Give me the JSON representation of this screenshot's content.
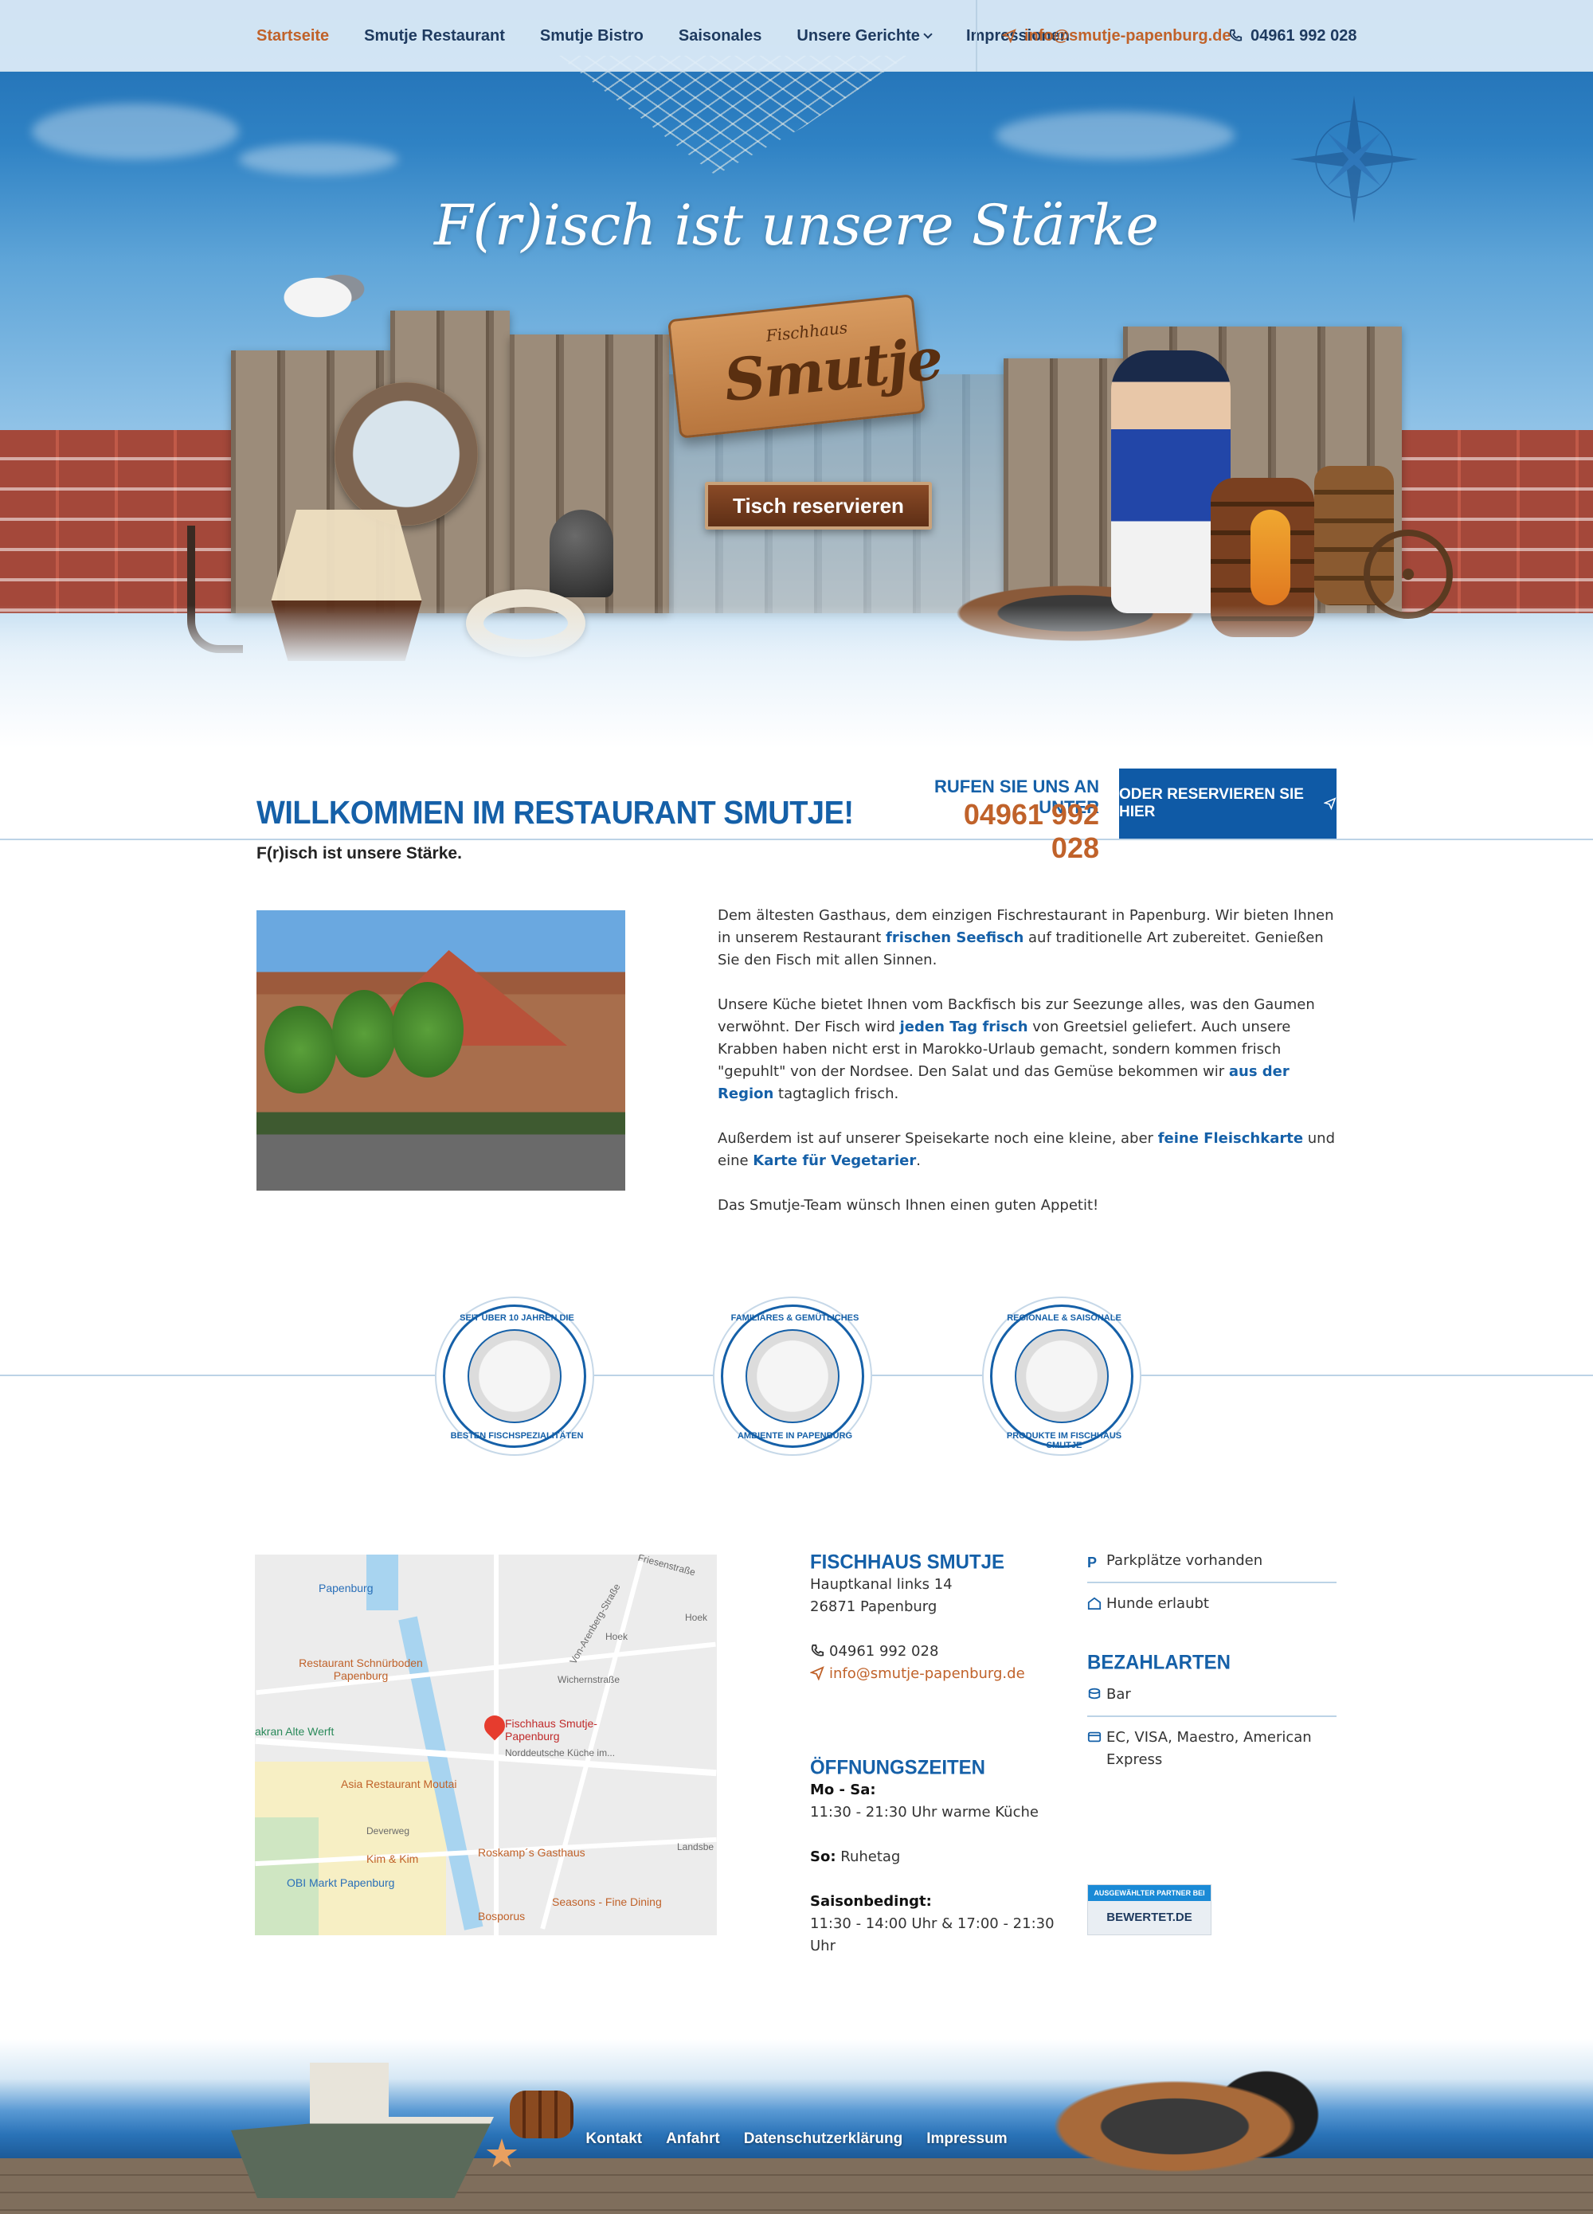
{
  "nav": {
    "items": [
      {
        "label": "Startseite",
        "active": true
      },
      {
        "label": "Smutje Restaurant"
      },
      {
        "label": "Smutje Bistro"
      },
      {
        "label": "Saisonales"
      },
      {
        "label": "Unsere Gerichte",
        "has_dropdown": true
      },
      {
        "label": "Impressionen"
      }
    ],
    "email": "info@smutje-papenburg.de",
    "phone": "04961 992 028"
  },
  "hero": {
    "title": "F(r)isch ist unsere Stärke",
    "logo_small": "Fischhaus",
    "logo_big": "Smutje",
    "reserve_button": "Tisch reservieren"
  },
  "welcome": {
    "title": "WILLKOMMEN IM RESTAURANT SMUTJE!",
    "subtitle": "F(r)isch ist unsere Stärke.",
    "call_label": "RUFEN SIE UNS AN UNTER",
    "call_number": "04961 992 028",
    "reserve_label": "ODER RESERVIEREN SIE HIER",
    "paragraphs": {
      "p1_a": "Dem ältesten Gasthaus, dem einzigen Fischrestaurant in Papenburg. Wir bieten Ihnen in unserem Restaurant ",
      "p1_hl": "frischen Seefisch",
      "p1_b": " auf traditionelle Art zubereitet. Genießen Sie den Fisch mit allen Sinnen.",
      "p2_a": "Unsere Küche bietet Ihnen vom Backfisch bis zur Seezunge alles, was den Gaumen verwöhnt. Der Fisch wird ",
      "p2_hl1": "jeden Tag frisch",
      "p2_b": " von Greetsiel geliefert. Auch unsere Krabben haben nicht erst in Marokko-Urlaub gemacht, sondern kommen frisch \"gepuhlt\" von der Nordsee. Den Salat und das Gemüse bekommen wir ",
      "p2_hl2": "aus der Region",
      "p2_c": " tagtaglich frisch.",
      "p3_a": "Außerdem ist auf unserer Speisekarte noch eine kleine, aber ",
      "p3_hl1": "feine Fleischkarte",
      "p3_b": " und eine ",
      "p3_hl2": "Karte für Vegetarier",
      "p3_c": ".",
      "p4": "Das Smutje-Team wünsch Ihnen einen guten Appetit!"
    }
  },
  "badges": [
    {
      "top": "SEIT ÜBER 10 JAHREN DIE",
      "bottom": "BESTEN FISCHSPEZIALITÄTEN",
      "icon": "anchor-icon"
    },
    {
      "top": "FAMILIÄRES & GEMÜTLICHES",
      "bottom": "AMBIENTE IN PAPENBURG",
      "icon": "shell-icon"
    },
    {
      "top": "REGIONALE & SAISONALE",
      "bottom": "PRODUKTE IM FISCHHAUS SMUTJE",
      "icon": "seafood-icon"
    }
  ],
  "map": {
    "labels": {
      "papenburg": "Papenburg",
      "friesenstrasse": "Friesenstraße",
      "schnurboden": "Restaurant Schnürboden Papenburg",
      "alte_werft": "akran Alte Werft",
      "fischhaus": "Fischhaus Smutje-Papenburg",
      "fischhaus_sub": "Norddeutsche Küche im...",
      "asia": "Asia Restaurant Moutai",
      "kim": "Kim & Kim",
      "obi": "OBI Markt Papenburg",
      "bosporus": "Bosporus",
      "roskamp": "Roskamp´s Gasthaus",
      "seasons": "Seasons - Fine Dining",
      "deverweg": "Deverweg",
      "landsberg": "Landsbe",
      "wichernstrasse": "Wichernstraße",
      "hoek": "Hoek",
      "hoek2": "Hoek",
      "von_arenberg": "Von-Arenberg-Straße"
    }
  },
  "address": {
    "heading": "FISCHHAUS SMUTJE",
    "street": "Hauptkanal links 14",
    "city": "26871 Papenburg",
    "phone": "04961 992 028",
    "email": "info@smutje-papenburg.de"
  },
  "hours": {
    "heading": "ÖFFNUNGSZEITEN",
    "weekday_label": "Mo - Sa:",
    "weekday_value": "11:30 - 21:30 Uhr warme Küche",
    "sunday_label": "So:",
    "sunday_value": " Ruhetag",
    "season_label": "Saisonbedingt:",
    "season_value": "11:30 - 14:00 Uhr & 17:00 - 21:30 Uhr"
  },
  "features": {
    "parking": "Parkplätze vorhanden",
    "dogs": "Hunde erlaubt"
  },
  "payment": {
    "heading": "BEZAHLARTEN",
    "cash": "Bar",
    "cards": "EC, VISA, Maestro, American Express"
  },
  "bewertet": {
    "top": "AUSGEWÄHLTER PARTNER BEI",
    "bottom": "BEWERTET.DE"
  },
  "footer": {
    "links": [
      "Kontakt",
      "Anfahrt",
      "Datenschutzerklärung",
      "Impressum"
    ]
  },
  "colors": {
    "primary_blue": "#1560a8",
    "accent_orange": "#c0622a",
    "nav_dark": "#1e3a5f"
  }
}
